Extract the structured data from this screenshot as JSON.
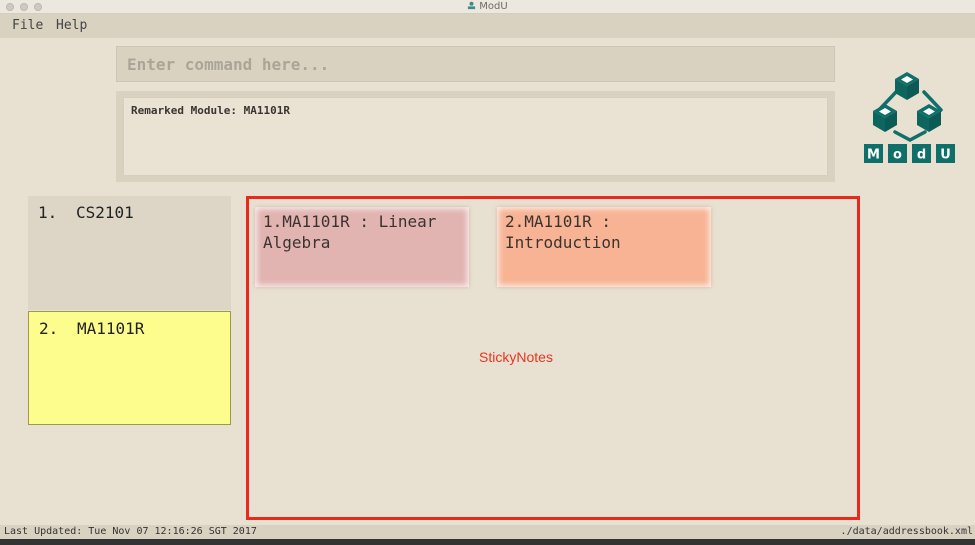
{
  "window": {
    "title": "ModU"
  },
  "menu": {
    "file_label": "File",
    "help_label": "Help"
  },
  "command": {
    "placeholder": "Enter command here..."
  },
  "result": {
    "text": "Remarked Module: MA1101R"
  },
  "logo": {
    "letters": [
      "M",
      "o",
      "d",
      "U"
    ],
    "color": "#0f6f6a"
  },
  "module_list": {
    "items": [
      {
        "index": "1.",
        "code": "CS2101"
      },
      {
        "index": "2.",
        "code": "MA1101R"
      }
    ]
  },
  "sticky_notes": {
    "label": "StickyNotes",
    "notes": [
      {
        "text": "1.MA1101R : Linear Algebra"
      },
      {
        "text": "2.MA1101R : Introduction"
      }
    ]
  },
  "status": {
    "last_updated": "Last Updated: Tue Nov 07 12:16:26 SGT 2017",
    "file_path": "./data/addressbook.xml"
  },
  "colors": {
    "highlight": "#e8291b",
    "selected_card": "#fdfd8e",
    "note_1": "#e1b4b1",
    "note_2": "#f7b394"
  }
}
